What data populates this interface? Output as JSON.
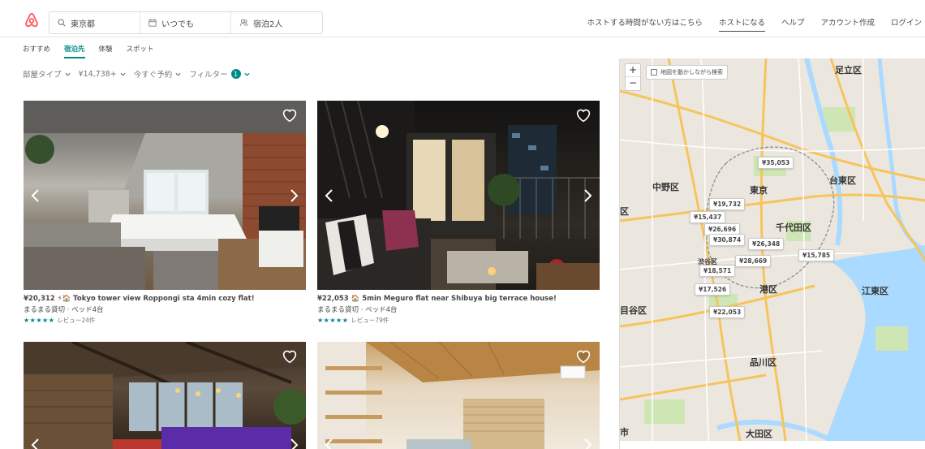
{
  "header": {
    "search_location": "東京都",
    "search_dates": "いつでも",
    "search_guests": "宿泊2人",
    "nav": [
      "ホストする時間がない方はこちら",
      "ホストになる",
      "ヘルプ",
      "アカウント作成",
      "ログイン"
    ]
  },
  "subnav": [
    "おすすめ",
    "宿泊先",
    "体験",
    "スポット"
  ],
  "filters": {
    "room_type": "部屋タイプ",
    "price": "¥14,738+",
    "instant": "今すぐ予約",
    "filter": "フィルター",
    "filter_count": "1"
  },
  "listings": [
    {
      "title": "¥20,312 ⚡🏠 Tokyo tower view Roppongi sta 4min cozy flat!",
      "subtitle": "まるまる貸切 · ベッド4台",
      "stars": "★★★★★",
      "reviews": "レビュー24件"
    },
    {
      "title": "¥22,053 🏠 5min Meguro flat near Shibuya big terrace house!",
      "subtitle": "まるまる貸切 · ベッド4台",
      "stars": "★★★★★",
      "reviews": "レビュー79件"
    }
  ],
  "map": {
    "checkbox_label": "地図を動かしながら検索",
    "zoom_in": "+",
    "zoom_out": "−",
    "places": {
      "adachi": "足立区",
      "nakano": "中野区",
      "tokyo": "東京",
      "taito": "台東区",
      "chiyoda": "千代田区",
      "minato": "港区",
      "shibuya": "渋谷区",
      "koto": "江東区",
      "meguro": "目谷区",
      "shinagawa": "品川区",
      "ota": "大田区",
      "shi": "市",
      "ku": "区"
    },
    "prices": [
      "¥35,053",
      "¥19,732",
      "¥15,437",
      "¥26,696",
      "¥30,874",
      "¥26,348",
      "¥15,785",
      "¥28,669",
      "¥18,571",
      "¥17,526",
      "¥22,053"
    ]
  }
}
